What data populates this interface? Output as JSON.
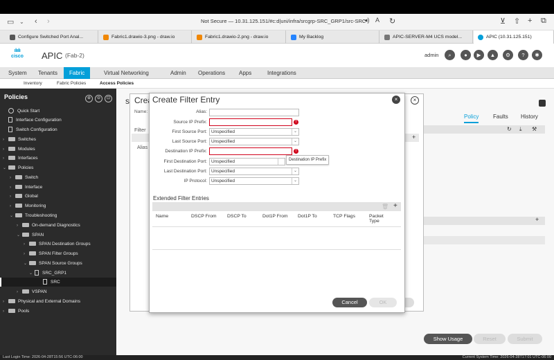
{
  "browser": {
    "url": "Not Secure — 10.31.125.151/#c:d|uni/infra/srcgrp-SRC_GRP1/src-SRC",
    "tabs": [
      {
        "label": "Configure Switched Port Anal...",
        "icon_color": "#555555"
      },
      {
        "label": "Fabric1.drawio-3.png - draw.io",
        "icon_color": "#f08705"
      },
      {
        "label": "Fabric1.drawio-2.png - draw.io",
        "icon_color": "#f08705"
      },
      {
        "label": "My Backlog",
        "icon_color": "#2684ff"
      },
      {
        "label": "APIC-SERVER-M4 UCS model...",
        "icon_color": "#777777"
      },
      {
        "label": "APIC (10.31.125.151)",
        "icon_color": "#049fd9"
      }
    ]
  },
  "header": {
    "logo": "cisco",
    "app_title": "APIC",
    "fabric": "(Fab-2)",
    "user": "admin"
  },
  "menu": {
    "items": [
      "System",
      "Tenants",
      "Fabric",
      "Virtual Networking",
      "Admin",
      "Operations",
      "Apps",
      "Integrations"
    ],
    "active": "Fabric",
    "subitems": [
      "Inventory",
      "Fabric Policies",
      "Access Policies"
    ],
    "active_sub": "Access Policies"
  },
  "sidebar": {
    "title": "Policies",
    "items": [
      {
        "label": "Quick Start"
      },
      {
        "label": "Interface Configuration"
      },
      {
        "label": "Switch Configuration"
      },
      {
        "label": "Switches"
      },
      {
        "label": "Modules"
      },
      {
        "label": "Interfaces"
      },
      {
        "label": "Policies"
      },
      {
        "label": "Switch"
      },
      {
        "label": "Interface"
      },
      {
        "label": "Global"
      },
      {
        "label": "Monitoring"
      },
      {
        "label": "Troubleshooting"
      },
      {
        "label": "On-demand Diagnostics"
      },
      {
        "label": "SPAN"
      },
      {
        "label": "SPAN Destination Groups"
      },
      {
        "label": "SPAN Filter Groups"
      },
      {
        "label": "SPAN Source Groups"
      },
      {
        "label": "SRC_GRP1"
      },
      {
        "label": "SRC"
      },
      {
        "label": "VSPAN"
      },
      {
        "label": "Physical and External Domains"
      },
      {
        "label": "Pools"
      }
    ]
  },
  "background_dialog": {
    "title": "Crea",
    "name_label": "Name:",
    "filter_label": "Filter",
    "alias_label": "Alias"
  },
  "right_panel": {
    "s_glyph": "s",
    "tabs": [
      "Policy",
      "Faults",
      "History"
    ],
    "active_tab": "Policy",
    "col_fragment": "col",
    "buttons": [
      "Show Usage",
      "Reset",
      "Submit"
    ]
  },
  "dialog": {
    "title": "Create Filter Entry",
    "fields": [
      {
        "label": "Alias:",
        "value": "",
        "type": "text",
        "error": false
      },
      {
        "label": "Source IP Prefix:",
        "value": "",
        "type": "text",
        "error": true
      },
      {
        "label": "First Source Port:",
        "value": "Unspecified",
        "type": "select",
        "error": false
      },
      {
        "label": "Last Source Port:",
        "value": "Unspecified",
        "type": "select",
        "error": false
      },
      {
        "label": "Destination IP Prefix:",
        "value": "",
        "type": "text",
        "error": true
      },
      {
        "label": "First Destination Port:",
        "value": "Unspecified",
        "type": "select",
        "error": false
      },
      {
        "label": "Last Destination Port:",
        "value": "Unspecified",
        "type": "select",
        "error": false
      },
      {
        "label": "IP Protocol:",
        "value": "Unspecified",
        "type": "select",
        "error": false
      }
    ],
    "tooltip": "Destination IP Prefix",
    "extended_title": "Extended Filter Entries",
    "columns": [
      "Name",
      "DSCP From",
      "DSCP To",
      "Dot1P From",
      "Dot1P To",
      "TCP Flags",
      "Packet Type"
    ],
    "cancel_label": "Cancel",
    "ok_label": "OK"
  },
  "status": {
    "last_login": "Last Login Time: 2026-04-28T15:56 UTC-06:00",
    "system_time": "Current System Time: 2026-04-28T17:01 UTC-06:00"
  },
  "colors": {
    "accent": "#049fd9",
    "error": "#d0021b",
    "sidebar_bg": "#2b2b2b"
  }
}
